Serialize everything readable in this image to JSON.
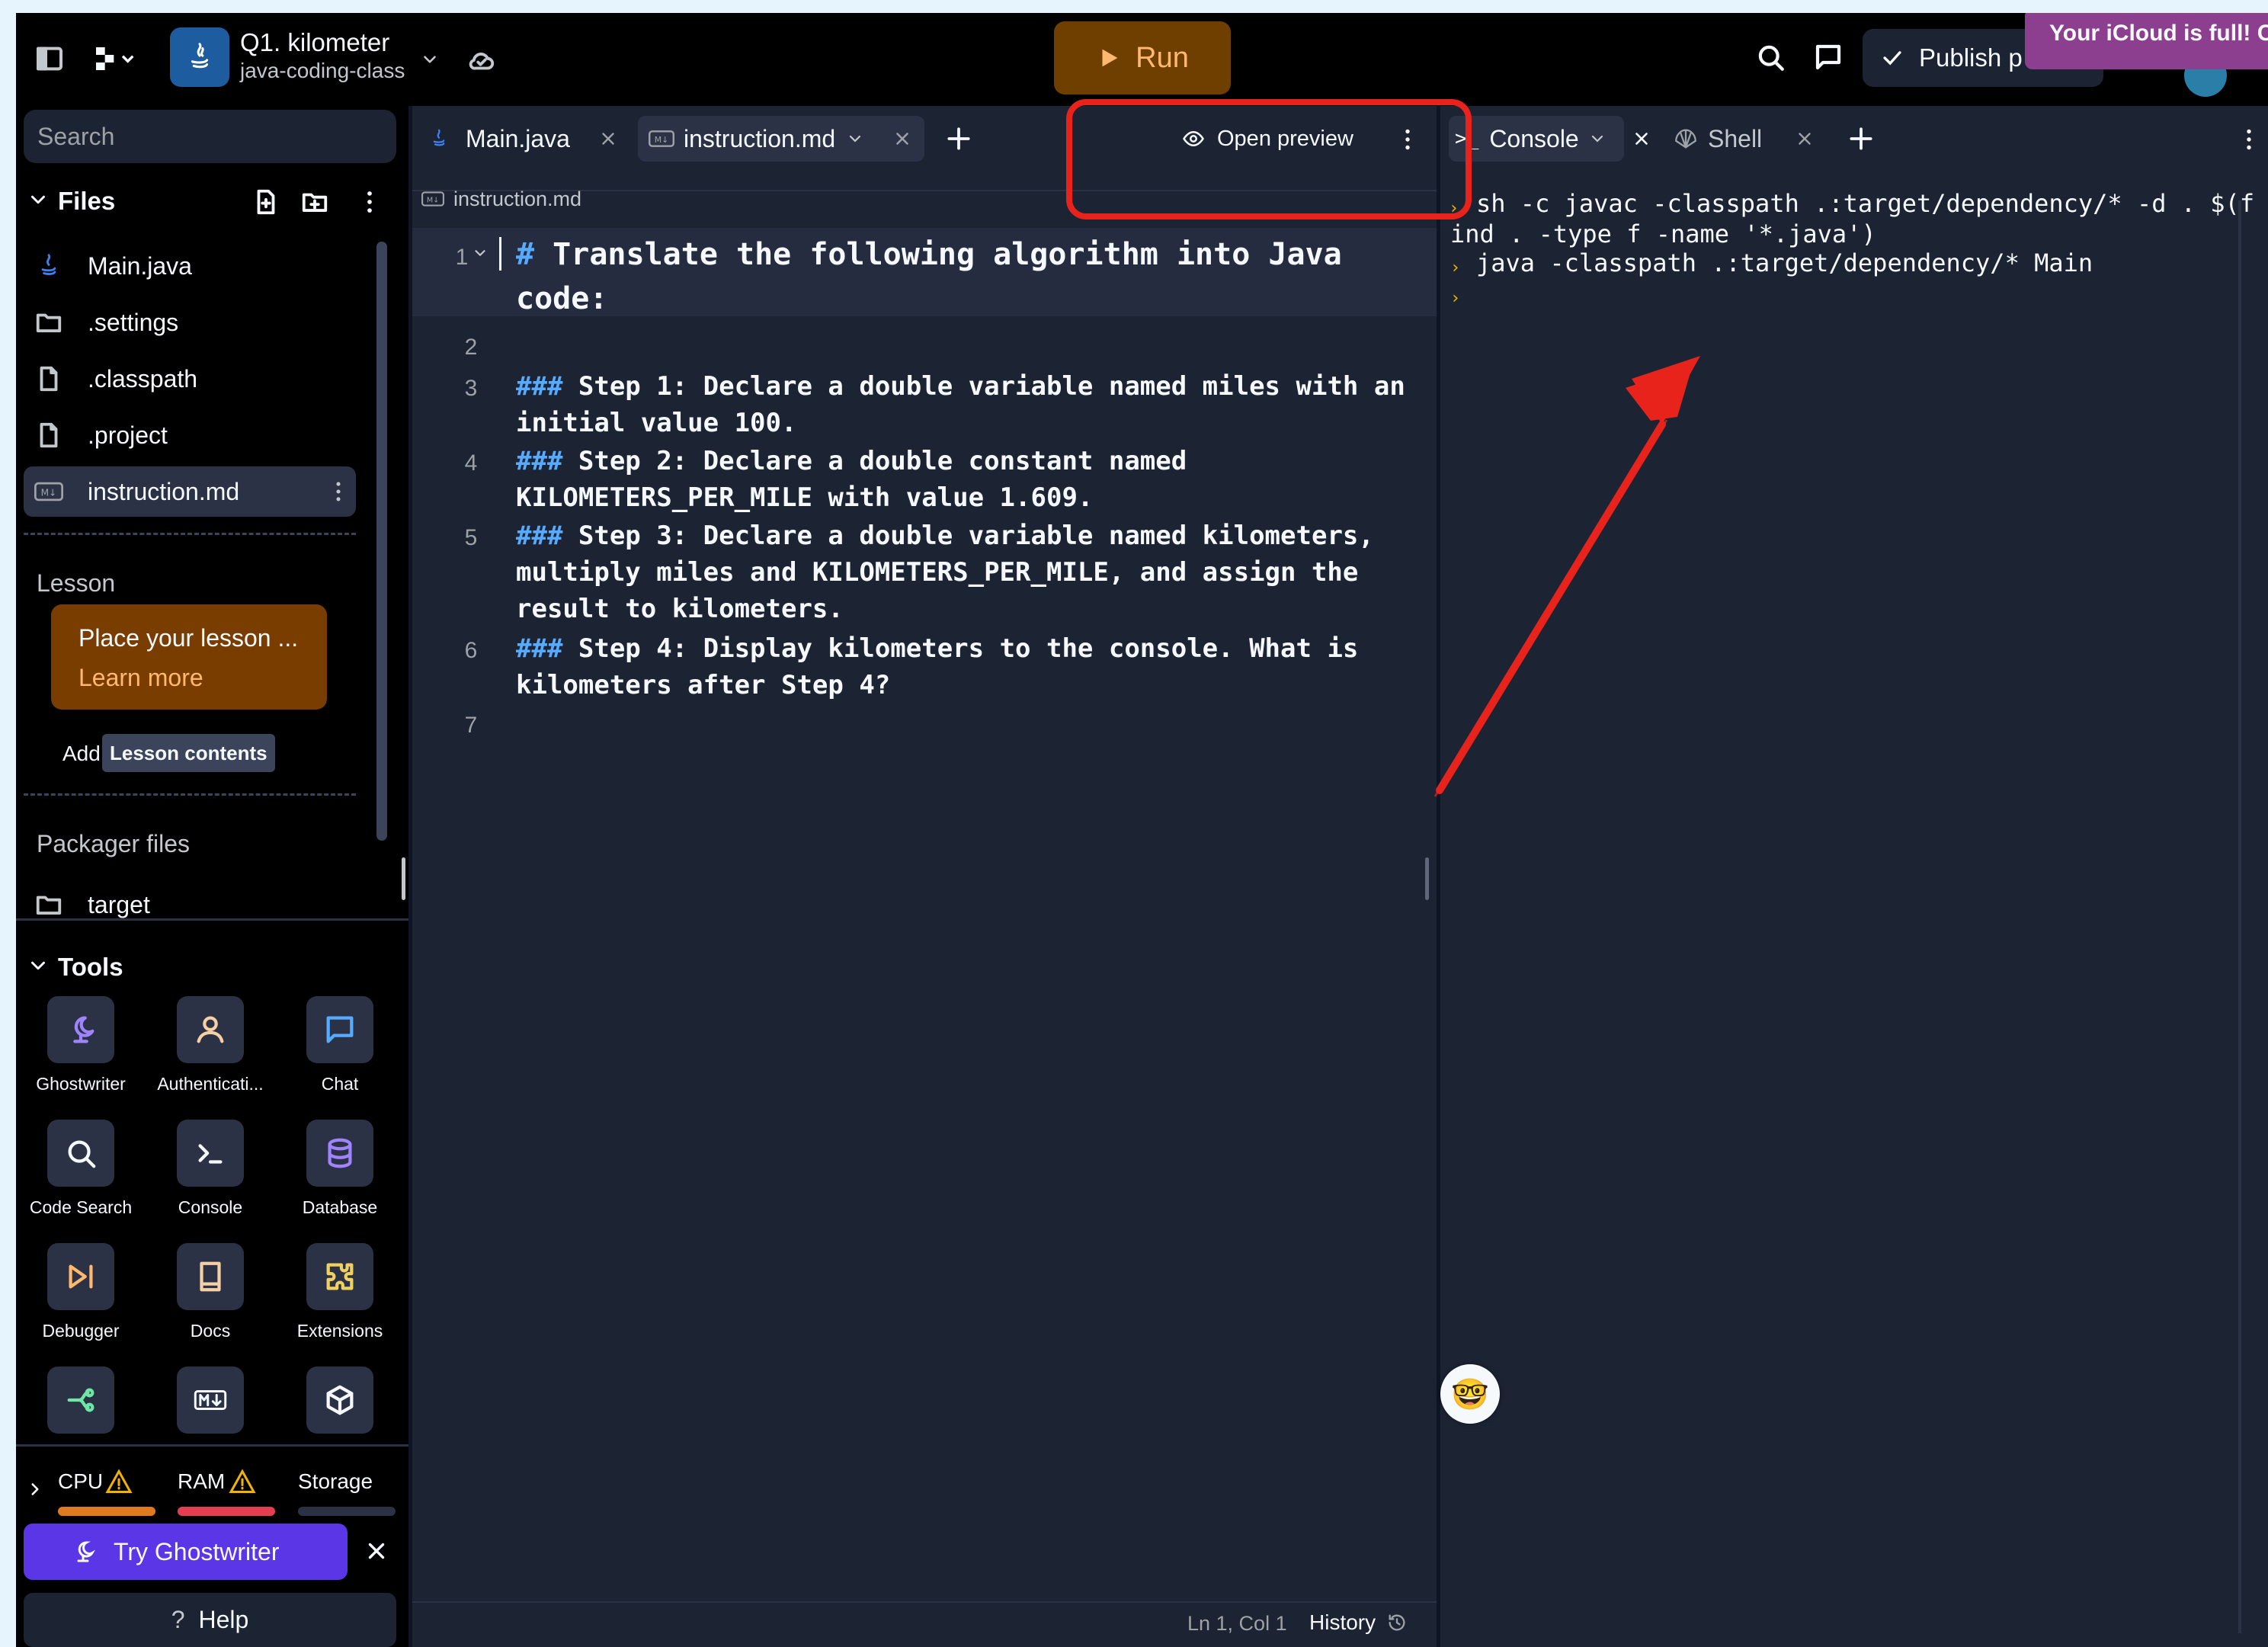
{
  "topbar": {
    "project_title": "Q1. kilometer",
    "project_subtitle": "java-coding-class",
    "run_label": "Run",
    "publish_label": "Publish p",
    "icloud_banner": "Your iCloud is full! C"
  },
  "sidebar": {
    "search_placeholder": "Search",
    "files_header": "Files",
    "files": [
      {
        "name": "Main.java",
        "icon": "java-icon"
      },
      {
        "name": ".settings",
        "icon": "folder-icon"
      },
      {
        "name": ".classpath",
        "icon": "file-icon"
      },
      {
        "name": ".project",
        "icon": "file-icon"
      },
      {
        "name": "instruction.md",
        "icon": "markdown-icon"
      }
    ],
    "lesson_header": "Lesson",
    "lesson_card_title": "Place your lesson ...",
    "lesson_card_link": "Learn more",
    "add_label": "Add",
    "lesson_tooltip": "Lesson contents",
    "packager_header": "Packager files",
    "packager_files": [
      {
        "name": "target",
        "icon": "folder-icon"
      }
    ],
    "tools_header": "Tools",
    "tools": [
      {
        "label": "Ghostwriter",
        "icon": "ghostwriter-icon"
      },
      {
        "label": "Authenticati...",
        "icon": "user-icon"
      },
      {
        "label": "Chat",
        "icon": "chat-icon"
      },
      {
        "label": "Code Search",
        "icon": "search-icon"
      },
      {
        "label": "Console",
        "icon": "terminal-icon"
      },
      {
        "label": "Database",
        "icon": "database-icon"
      },
      {
        "label": "Debugger",
        "icon": "debugger-icon"
      },
      {
        "label": "Docs",
        "icon": "book-icon"
      },
      {
        "label": "Extensions",
        "icon": "puzzle-icon"
      },
      {
        "label": "",
        "icon": "git-icon"
      },
      {
        "label": "",
        "icon": "markdown-icon"
      },
      {
        "label": "",
        "icon": "package-icon"
      }
    ],
    "resources": {
      "cpu_label": "CPU",
      "ram_label": "RAM",
      "storage_label": "Storage",
      "cpu_color": "#e07a1f",
      "ram_color": "#e53e50",
      "storage_color": "#2b3245"
    },
    "ghostwriter_button": "Try Ghostwriter",
    "help_label": "Help"
  },
  "editor": {
    "tabs": [
      {
        "label": "Main.java",
        "icon": "java-icon",
        "active": false
      },
      {
        "label": "instruction.md",
        "icon": "markdown-icon",
        "active": true
      }
    ],
    "open_preview_label": "Open preview",
    "breadcrumb": "instruction.md",
    "lines": [
      {
        "number": "1",
        "rows": [
          {
            "hash": "#",
            "text": " Translate the following algorithm into Java"
          },
          {
            "hash": "",
            "text": "code:"
          }
        ]
      },
      {
        "number": "2",
        "rows": [
          {
            "hash": "",
            "text": ""
          }
        ]
      },
      {
        "number": "3",
        "rows": [
          {
            "hash": "###",
            "text": " Step 1: Declare a double variable named miles with an"
          },
          {
            "hash": "",
            "text": "initial value 100."
          }
        ]
      },
      {
        "number": "4",
        "rows": [
          {
            "hash": "###",
            "text": " Step 2: Declare a double constant named"
          },
          {
            "hash": "",
            "text": "KILOMETERS_PER_MILE with value 1.609."
          }
        ]
      },
      {
        "number": "5",
        "rows": [
          {
            "hash": "###",
            "text": " Step 3: Declare a double variable named kilometers,"
          },
          {
            "hash": "",
            "text": "multiply miles and KILOMETERS_PER_MILE, and assign the"
          },
          {
            "hash": "",
            "text": "result to kilometers."
          }
        ]
      },
      {
        "number": "6",
        "rows": [
          {
            "hash": "###",
            "text": " Step 4: Display kilometers to the console. What is"
          },
          {
            "hash": "",
            "text": "kilometers after Step 4?"
          }
        ]
      },
      {
        "number": "7",
        "rows": [
          {
            "hash": "",
            "text": ""
          }
        ]
      }
    ],
    "status_position": "Ln 1, Col 1",
    "history_label": "History"
  },
  "console": {
    "tabs": [
      {
        "label": "Console",
        "icon": "terminal-icon",
        "active": true
      },
      {
        "label": "Shell",
        "icon": "shell-icon",
        "active": false
      }
    ],
    "output": [
      "sh -c javac -classpath .:target/dependency/* -d . $(f",
      "ind . -type f -name '*.java')",
      "java -classpath .:target/dependency/* Main"
    ],
    "avatar_emoji": "🤓"
  },
  "colors": {
    "run_bg": "#6f3f00",
    "run_fg": "#ffb96e",
    "annotation_red": "#e8231c",
    "accent_purple": "#5a36e6",
    "lesson_card_bg": "#7a3d00",
    "icloud_bg": "#8c3f8e"
  }
}
